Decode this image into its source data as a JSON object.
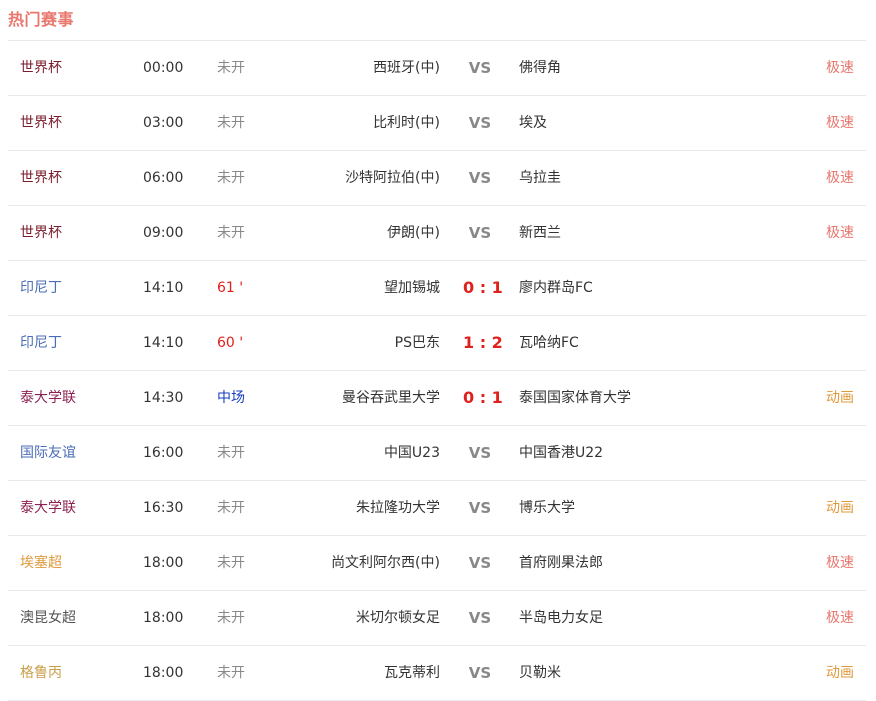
{
  "section": {
    "title": "热门赛事"
  },
  "colors": {
    "title": "#e8776d",
    "score": "#e0201c",
    "link_red": "#e8776d",
    "link_orange": "#e09a3c"
  },
  "matches": [
    {
      "league": "世界杯",
      "league_color": "#7a1d2d",
      "time": "00:00",
      "status": "未开",
      "status_color": "#888888",
      "home": "西班牙(中)",
      "vs": "VS",
      "is_score": false,
      "away": "佛得角",
      "link": "极速",
      "link_color": "#e8776d"
    },
    {
      "league": "世界杯",
      "league_color": "#7a1d2d",
      "time": "03:00",
      "status": "未开",
      "status_color": "#888888",
      "home": "比利时(中)",
      "vs": "VS",
      "is_score": false,
      "away": "埃及",
      "link": "极速",
      "link_color": "#e8776d"
    },
    {
      "league": "世界杯",
      "league_color": "#7a1d2d",
      "time": "06:00",
      "status": "未开",
      "status_color": "#888888",
      "home": "沙特阿拉伯(中)",
      "vs": "VS",
      "is_score": false,
      "away": "乌拉圭",
      "link": "极速",
      "link_color": "#e8776d"
    },
    {
      "league": "世界杯",
      "league_color": "#7a1d2d",
      "time": "09:00",
      "status": "未开",
      "status_color": "#888888",
      "home": "伊朗(中)",
      "vs": "VS",
      "is_score": false,
      "away": "新西兰",
      "link": "极速",
      "link_color": "#e8776d"
    },
    {
      "league": "印尼丁",
      "league_color": "#4b6cb7",
      "time": "14:10",
      "status": "61 '",
      "status_color": "#e0201c",
      "home": "望加锡城",
      "vs": "0 : 1",
      "is_score": true,
      "away": "廖内群岛FC",
      "link": "",
      "link_color": "#e8776d"
    },
    {
      "league": "印尼丁",
      "league_color": "#4b6cb7",
      "time": "14:10",
      "status": "60 '",
      "status_color": "#e0201c",
      "home": "PS巴东",
      "vs": "1 : 2",
      "is_score": true,
      "away": "瓦哈纳FC",
      "link": "",
      "link_color": "#e8776d"
    },
    {
      "league": "泰大学联",
      "league_color": "#8b2252",
      "time": "14:30",
      "status": "中场",
      "status_color": "#1a3ec2",
      "home": "曼谷吞武里大学",
      "vs": "0 : 1",
      "is_score": true,
      "away": "泰国国家体育大学",
      "link": "动画",
      "link_color": "#e09a3c"
    },
    {
      "league": "国际友谊",
      "league_color": "#4b6cb7",
      "time": "16:00",
      "status": "未开",
      "status_color": "#888888",
      "home": "中国U23",
      "vs": "VS",
      "is_score": false,
      "away": "中国香港U22",
      "link": "",
      "link_color": "#e8776d"
    },
    {
      "league": "泰大学联",
      "league_color": "#8b2252",
      "time": "16:30",
      "status": "未开",
      "status_color": "#888888",
      "home": "朱拉隆功大学",
      "vs": "VS",
      "is_score": false,
      "away": "博乐大学",
      "link": "动画",
      "link_color": "#e09a3c"
    },
    {
      "league": "埃塞超",
      "league_color": "#e09a3c",
      "time": "18:00",
      "status": "未开",
      "status_color": "#888888",
      "home": "尚文利阿尔西(中)",
      "vs": "VS",
      "is_score": false,
      "away": "首府刚果法郎",
      "link": "极速",
      "link_color": "#e8776d"
    },
    {
      "league": "澳昆女超",
      "league_color": "#555555",
      "time": "18:00",
      "status": "未开",
      "status_color": "#888888",
      "home": "米切尔顿女足",
      "vs": "VS",
      "is_score": false,
      "away": "半岛电力女足",
      "link": "极速",
      "link_color": "#e8776d"
    },
    {
      "league": "格鲁丙",
      "league_color": "#c9a04a",
      "time": "18:00",
      "status": "未开",
      "status_color": "#888888",
      "home": "瓦克蒂利",
      "vs": "VS",
      "is_score": false,
      "away": "贝勒米",
      "link": "动画",
      "link_color": "#e09a3c"
    }
  ]
}
